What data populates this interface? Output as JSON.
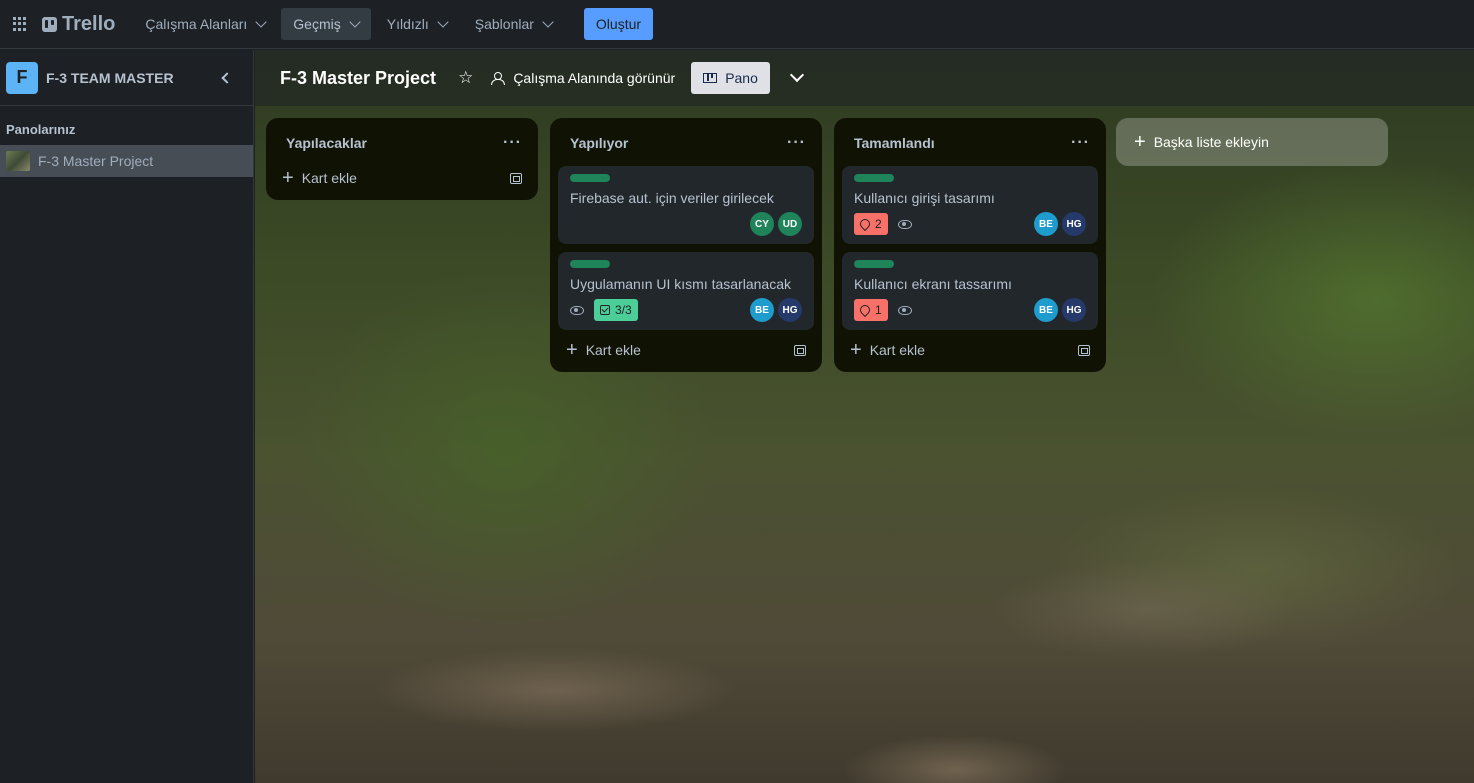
{
  "topbar": {
    "logo": "Trello",
    "nav": [
      "Çalışma Alanları",
      "Geçmiş",
      "Yıldızlı",
      "Şablonlar"
    ],
    "create": "Oluştur"
  },
  "sidebar": {
    "workspace_initial": "F",
    "workspace_name": "F-3 TEAM MASTER",
    "boards_title": "Panolarınız",
    "boards": [
      {
        "label": "F-3 Master Project"
      }
    ]
  },
  "board": {
    "title": "F-3 Master Project",
    "visibility": "Çalışma Alanında görünür",
    "view": "Pano",
    "add_list": "Başka liste ekleyin",
    "add_card": "Kart ekle",
    "lists": [
      {
        "title": "Yapılacaklar",
        "cards": []
      },
      {
        "title": "Yapılıyor",
        "cards": [
          {
            "title": "Firebase aut. için veriler girilecek",
            "members": [
              "CY",
              "UD"
            ]
          },
          {
            "title": "Uygulamanın UI kısmı tasarlanacak",
            "checklist": "3/3",
            "members": [
              "BE",
              "HG"
            ]
          }
        ]
      },
      {
        "title": "Tamamlandı",
        "cards": [
          {
            "title": "Kullanıcı girişi tasarımı",
            "due": "2",
            "members": [
              "BE",
              "HG"
            ]
          },
          {
            "title": "Kullanıcı ekranı tassarımı",
            "due": "1",
            "members": [
              "BE",
              "HG"
            ]
          }
        ]
      }
    ]
  },
  "colors": {
    "label_green": "#1f845a",
    "avatar_cy": "#1f845a",
    "avatar_ud": "#1f845a",
    "avatar_be": "#1d9ccd",
    "avatar_hg": "#253a6b",
    "create_button": "#579dff",
    "checklist_badge": "#4bce97",
    "due_badge": "#f87168"
  }
}
